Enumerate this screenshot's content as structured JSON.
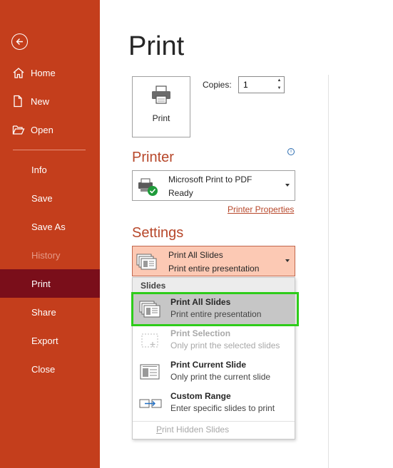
{
  "sidebar": {
    "items": [
      {
        "label": "Home"
      },
      {
        "label": "New"
      },
      {
        "label": "Open"
      },
      {
        "label": "Info"
      },
      {
        "label": "Save"
      },
      {
        "label": "Save As"
      },
      {
        "label": "History"
      },
      {
        "label": "Print"
      },
      {
        "label": "Share"
      },
      {
        "label": "Export"
      },
      {
        "label": "Close"
      }
    ]
  },
  "main": {
    "title": "Print",
    "print_button_label": "Print",
    "copies_label": "Copies:",
    "copies_value": "1",
    "printer_heading": "Printer",
    "printer_name": "Microsoft Print to PDF",
    "printer_status": "Ready",
    "printer_properties": "Printer Properties",
    "settings_heading": "Settings",
    "settings_line1": "Print All Slides",
    "settings_line2": "Print entire presentation"
  },
  "menu": {
    "header": "Slides",
    "items": [
      {
        "title": "Print All Slides",
        "desc": "Print entire presentation"
      },
      {
        "title": "Print Selection",
        "desc": "Only print the selected slides"
      },
      {
        "title": "Print Current Slide",
        "desc": "Only print the current slide"
      },
      {
        "title": "Custom Range",
        "desc": "Enter specific slides to print"
      }
    ],
    "hidden_first": "P",
    "hidden_rest": "rint Hidden Slides"
  },
  "colors": {
    "sidebar": "#c43e1c",
    "sidebar_active": "#7a0e1a",
    "accent_text": "#b7472a",
    "settings_bg": "#fcc9b4",
    "highlight": "#2ecc1a"
  }
}
